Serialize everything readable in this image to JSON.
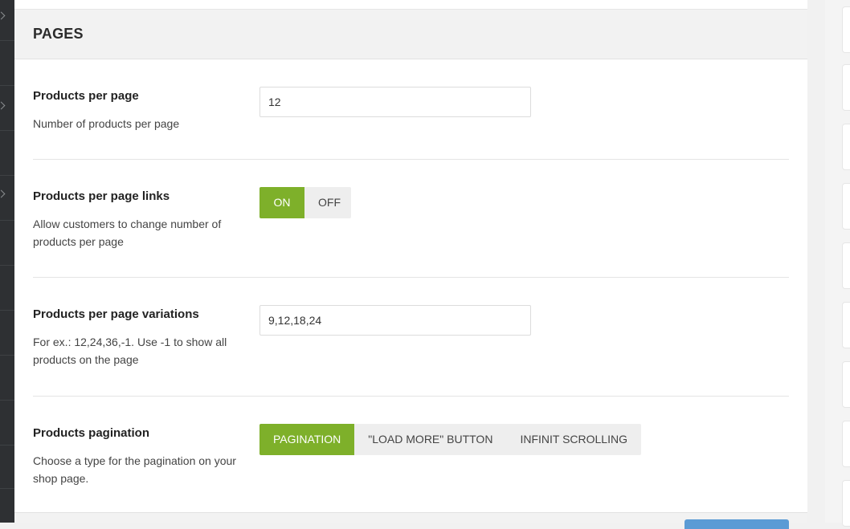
{
  "section": {
    "title": "PAGES"
  },
  "settings": [
    {
      "label": "Products per page",
      "description": "Number of products per page",
      "value": "12"
    },
    {
      "label": "Products per page links",
      "description": "Allow customers to change number of products per page",
      "options": [
        "ON",
        "OFF"
      ],
      "selected": "ON"
    },
    {
      "label": "Products per page variations",
      "description": "For ex.: 12,24,36,-1. Use -1 to show all products on the page",
      "value": "9,12,18,24"
    },
    {
      "label": "Products pagination",
      "description": "Choose a type for the pagination on your shop page.",
      "options": [
        "PAGINATION",
        "\"LOAD MORE\" BUTTON",
        "INFINIT SCROLLING"
      ],
      "selected": "PAGINATION"
    }
  ],
  "colors": {
    "accent": "#7eb02a",
    "toggle_inactive_bg": "#eeeeee",
    "header_bg": "#f2f2f2",
    "left_sidebar_bg": "#2e3033",
    "save_button": "#5b9bd5"
  },
  "icons": {
    "left_menu_chevron": "chevron-icon"
  }
}
